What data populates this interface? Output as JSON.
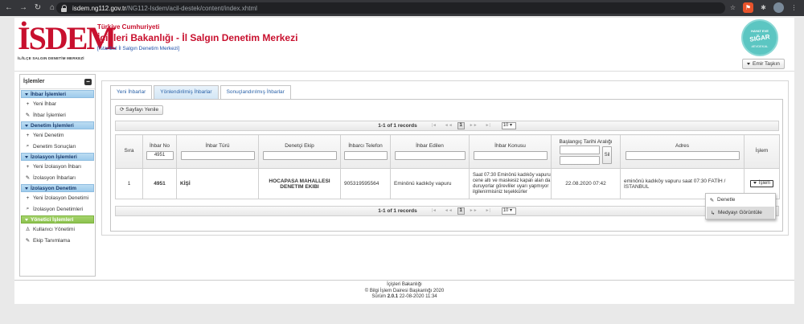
{
  "browser": {
    "url_host": "isdem.ng112.gov.tr",
    "url_path": "/NG112-Isdem/acil-destek/content/index.xhtml"
  },
  "header": {
    "logo_text": "İSDEM",
    "logo_sub": "İL/İLÇE SALGIN DENETİM MERKEZİ",
    "line1": "Türkiye Cumhuriyeti",
    "line2": "İçişleri Bakanlığı - İl Salgın Denetim Merkezi",
    "line3": "[İstanbul İl Salgın Denetim Merkezi]",
    "badge_top": "HAYAT EVE",
    "badge_main": "SIĞAR",
    "badge_bottom": "#EVDEKAL",
    "user_button": "Emir Taşkın"
  },
  "sidebar": {
    "title": "İşlemler",
    "groups": [
      {
        "label": "İhbar İşlemleri",
        "items": [
          {
            "label": "Yeni İhbar",
            "icon": "+"
          },
          {
            "label": "İhbar İşlemleri",
            "icon": "✎"
          }
        ]
      },
      {
        "label": "Denetim İşlemleri",
        "items": [
          {
            "label": "Yeni Denetim",
            "icon": "+"
          },
          {
            "label": "Denetim Sonuçları",
            "icon": "⌕"
          }
        ]
      },
      {
        "label": "İzolasyon İşlemleri",
        "items": [
          {
            "label": "Yeni İzolasyon İhbarı",
            "icon": "+"
          },
          {
            "label": "İzolasyon İhbarları",
            "icon": "✎"
          }
        ]
      },
      {
        "label": "İzolasyon Denetim",
        "items": [
          {
            "label": "Yeni İzolasyon Denetimi",
            "icon": "+"
          },
          {
            "label": "İzolasyon Denetimleri",
            "icon": "⌕"
          }
        ]
      },
      {
        "label": "Yönetici İşlemleri",
        "items": [
          {
            "label": "Kullanıcı Yönetimi",
            "icon": "♙"
          },
          {
            "label": "Ekip Tanımlama",
            "icon": "✎"
          }
        ]
      }
    ]
  },
  "tabs": [
    "Yeni İhbarlar",
    "Yönlendirilmiş İhbarlar",
    "Sonuçlandırılmış İhbarlar"
  ],
  "toolbar": {
    "refresh_label": "Sayfayı Yenile"
  },
  "paginator": {
    "records": "1-1 of 1 records",
    "page": "1",
    "rows_per_page": "10"
  },
  "table": {
    "headers": {
      "sira": "Sıra",
      "ihbar_no": "İhbar No",
      "ihbar_turu": "İhbar Türü",
      "denetci_ekip": "Denetçi Ekip",
      "ihbarci_telefon": "İhbarcı Telefon",
      "ihbar_edilen": "İhbar Edilen",
      "ihbar_konusu": "İhbar Konusu",
      "baslangic_tarihi": "Başlangıç Tarihi Aralığı",
      "adres": "Adres",
      "islem": "İşlem"
    },
    "filters": {
      "ihbar_no": "4951",
      "sil_button": "Sil"
    },
    "rows": [
      {
        "sira": "1",
        "ihbar_no": "4951",
        "ihbar_turu": "KİŞİ",
        "denetci_ekip": "HOCAPASA MAHALLESI DENETIM EKIBI",
        "ihbarci_telefon": "905319595564",
        "ihbar_edilen": "Eminönü kadıköy vapuru",
        "ihbar_konusu": "Saat 07:30 Eminönü kadıköy vapuru cene altı ve maskesiz kapalı alan da duruyorlar görevliler uyarı yapmıyor ilgilenirmisiniz teşekkürler",
        "baslangic_tarihi": "22.08.2020 07:42",
        "adres": "eminönü kadıköy vapuru saat 07:30 FATİH / İSTANBUL",
        "islem_button": "İşlem"
      }
    ]
  },
  "context_menu": [
    "Denetle",
    "Medyayı Görüntüle"
  ],
  "footer": {
    "line1": "İçişleri Bakanlığı",
    "line2": "© Bilgi İşlem Dairesi Başkanlığı 2020",
    "version_prefix": "Sürüm ",
    "version": "2.0.1",
    "version_suffix": " 22-08-2020 11:34"
  }
}
